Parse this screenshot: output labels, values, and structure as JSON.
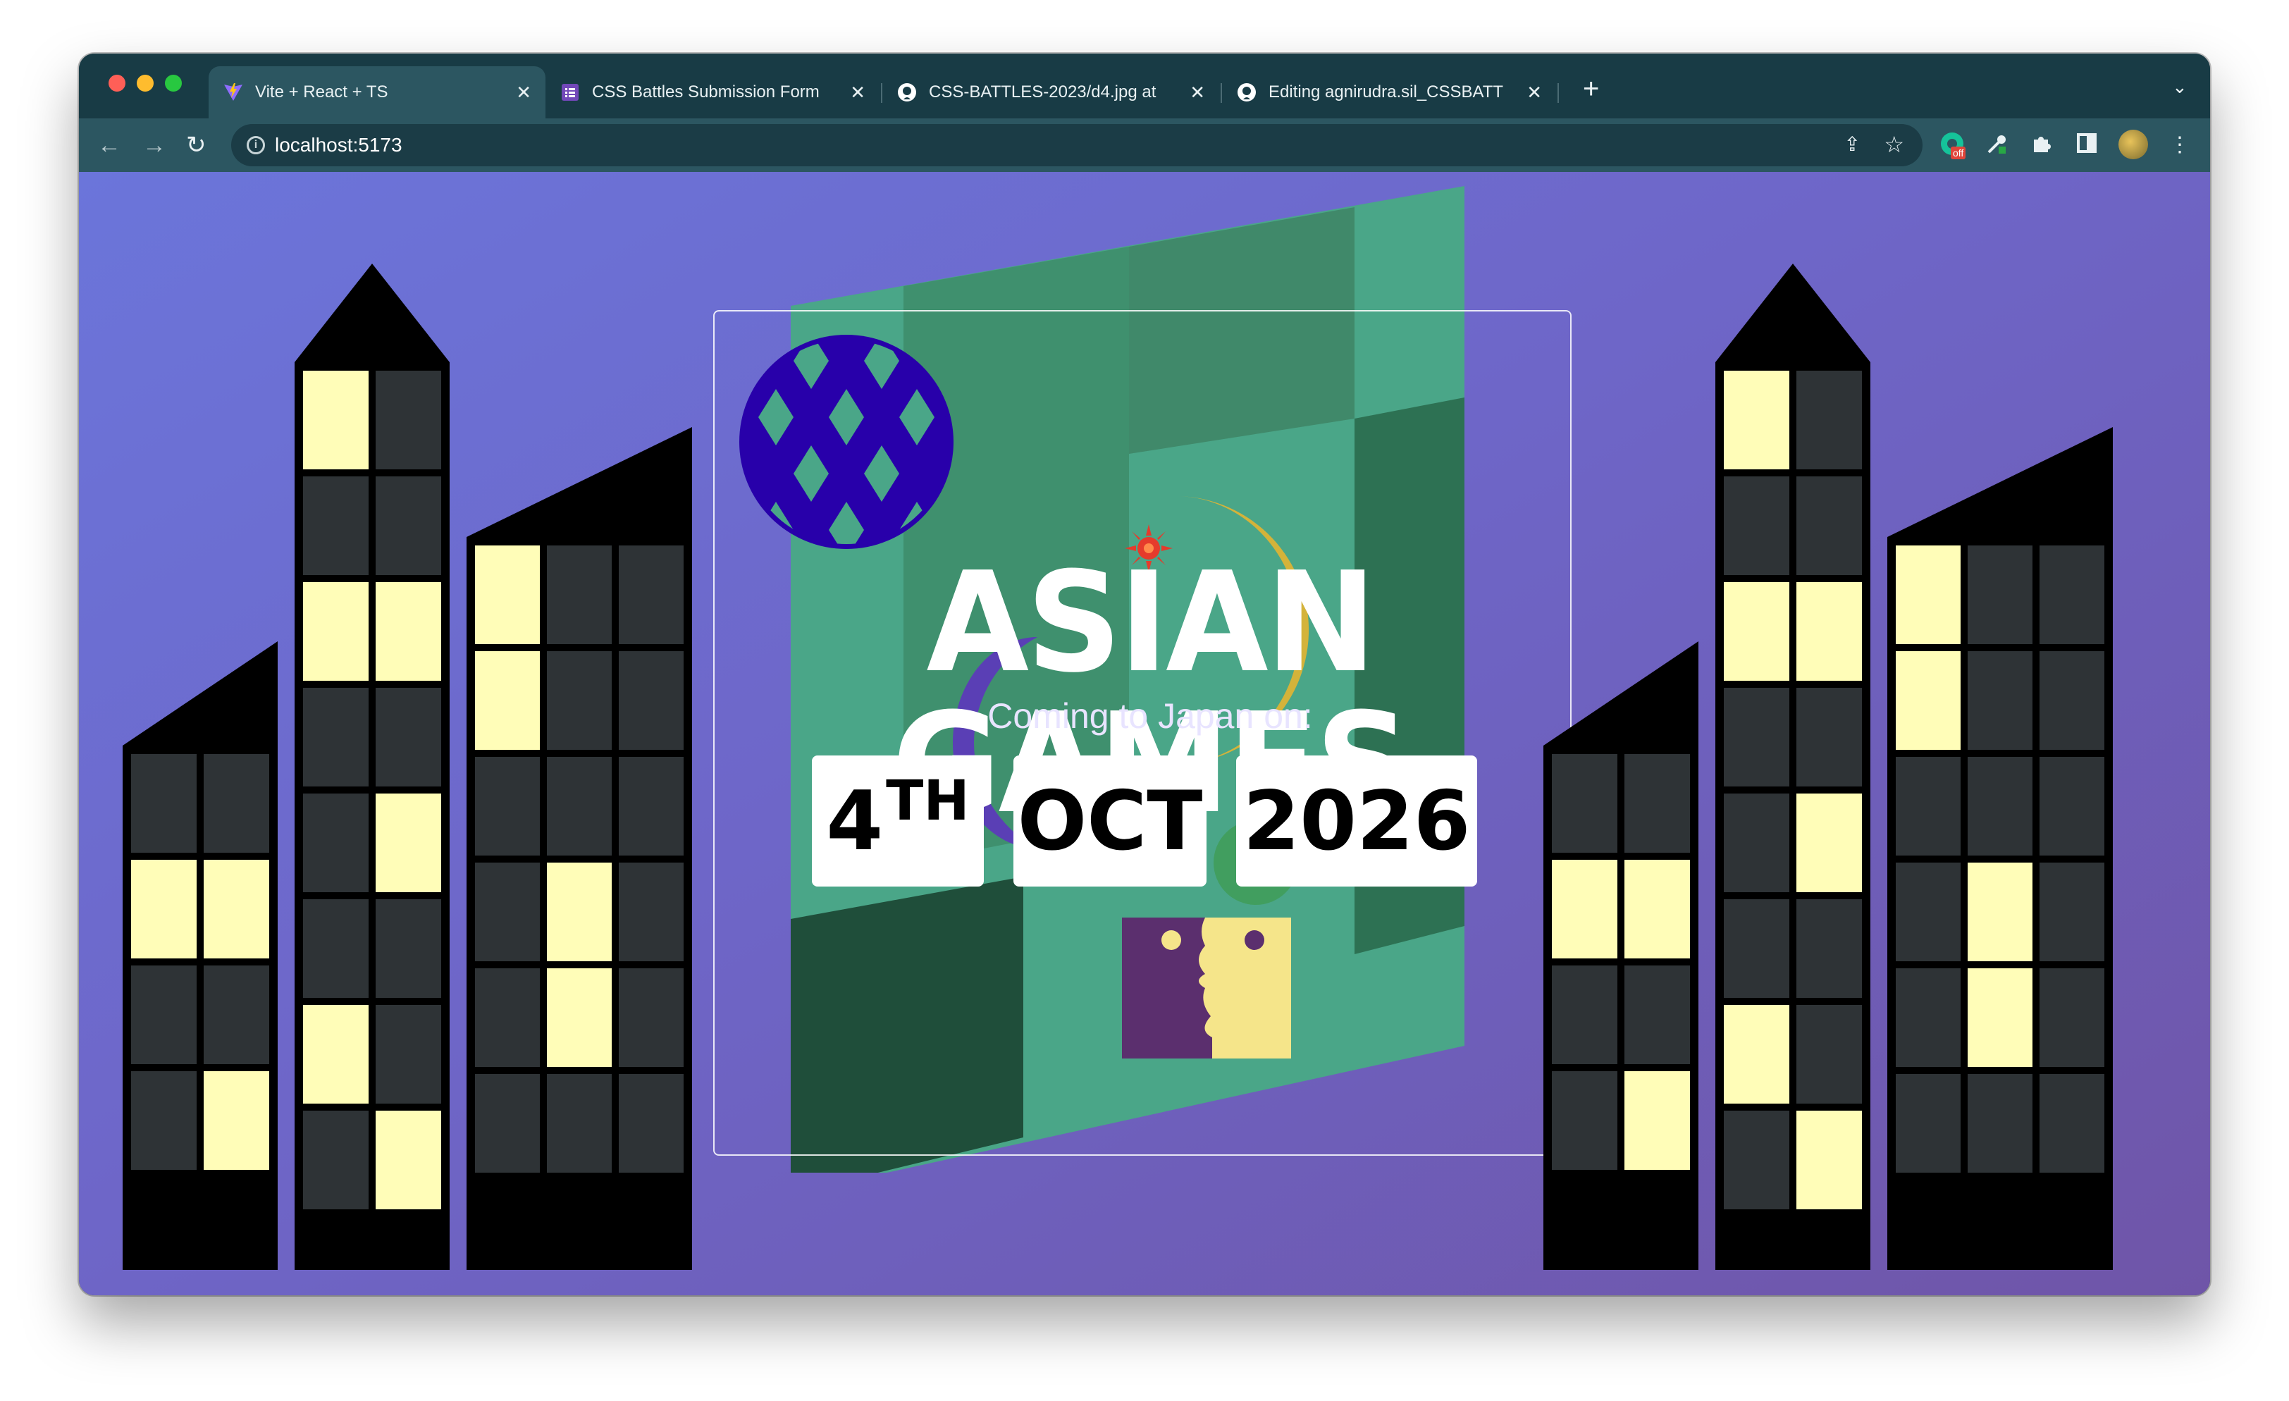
{
  "window": {
    "traffic_lights": [
      "#ff5f57",
      "#febc2e",
      "#28c840"
    ]
  },
  "tabs": [
    {
      "label": "Vite + React + TS",
      "icon": "vite-icon",
      "active": true
    },
    {
      "label": "CSS Battles Submission Form",
      "icon": "forms-icon",
      "active": false
    },
    {
      "label": "CSS-BATTLES-2023/d4.jpg at",
      "icon": "github-icon",
      "active": false
    },
    {
      "label": "Editing agnirudra.sil_CSSBATT",
      "icon": "github-icon",
      "active": false
    }
  ],
  "toolbar": {
    "url": "localhost:5173",
    "extension_badge": "off"
  },
  "poster": {
    "title": "ASIAN GAMES",
    "subtitle": "Coming to Japan on:",
    "day": "4",
    "day_suffix": "TH",
    "month": "OCT",
    "year": "2026"
  },
  "colors": {
    "background_top": "#6b75da",
    "background_bottom": "#6f55a8",
    "window_lit": "#fffdb8",
    "window_dark": "#2e3336",
    "building": "#000000",
    "ball": "#2800aa",
    "ball_hex": "#4aa688",
    "panel_green": "#4aa688"
  }
}
